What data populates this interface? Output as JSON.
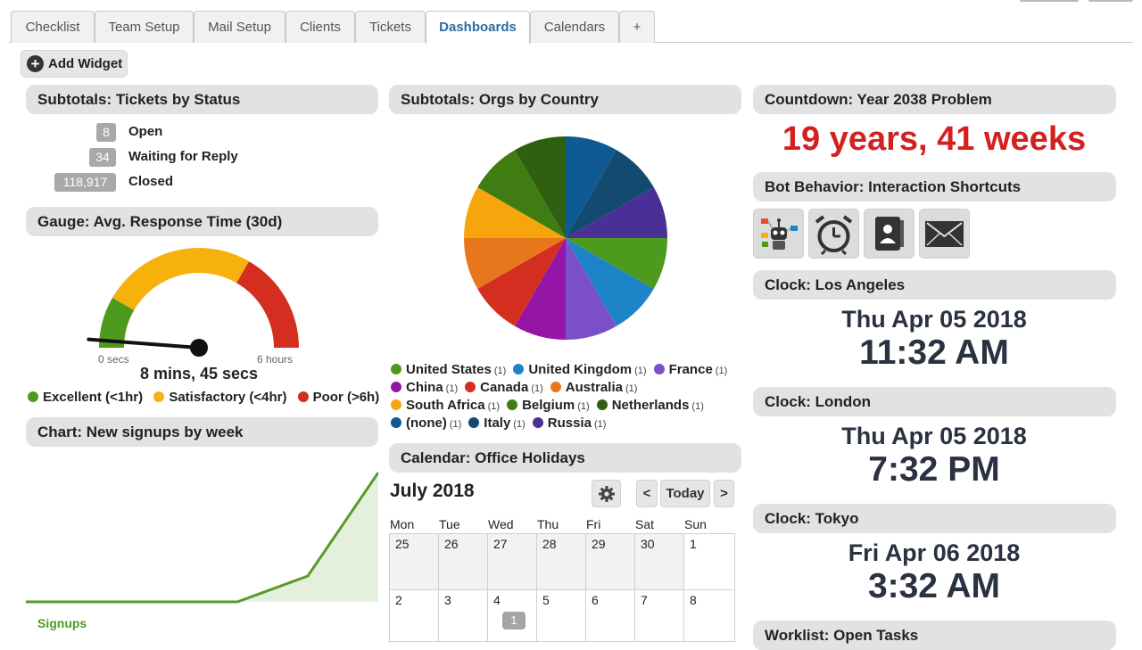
{
  "tabs": [
    {
      "label": "Checklist"
    },
    {
      "label": "Team Setup"
    },
    {
      "label": "Mail Setup"
    },
    {
      "label": "Clients"
    },
    {
      "label": "Tickets"
    },
    {
      "label": "Dashboards",
      "active": true
    },
    {
      "label": "Calendars"
    },
    {
      "label": "+"
    }
  ],
  "toolbar": {
    "add_widget": "Add Widget"
  },
  "tickets_status": {
    "title": "Subtotals: Tickets by Status",
    "rows": [
      {
        "count": "8",
        "label": "Open"
      },
      {
        "count": "34",
        "label": "Waiting for Reply"
      },
      {
        "count": "118,917",
        "label": "Closed"
      }
    ]
  },
  "gauge": {
    "title": "Gauge: Avg. Response Time (30d)",
    "min_label": "0 secs",
    "max_label": "6 hours",
    "value_label": "8 mins, 45 secs",
    "value_fraction": 0.024,
    "bands": [
      {
        "label": "Excellent (<1hr)",
        "color": "#4e9a1d",
        "to": 0.167
      },
      {
        "label": "Satisfactory (<4hr)",
        "color": "#f6b10c",
        "to": 0.667
      },
      {
        "label": "Poor (>6h)",
        "color": "#d42e20",
        "to": 1.0
      }
    ]
  },
  "signups_chart": {
    "title": "Chart: New signups by week",
    "legend": "Signups",
    "color": "#5a9a28"
  },
  "chart_data": {
    "type": "area",
    "series": [
      {
        "name": "Signups",
        "values": [
          0,
          0,
          0,
          0,
          1,
          5
        ]
      }
    ],
    "ylim": [
      0,
      5
    ]
  },
  "orgs_country": {
    "title": "Subtotals: Orgs by Country",
    "items": [
      {
        "label": "United States",
        "count": "(1)",
        "color": "#4e9a1d"
      },
      {
        "label": "United Kingdom",
        "count": "(1)",
        "color": "#1e84c8"
      },
      {
        "label": "France",
        "count": "(1)",
        "color": "#7b4fc8"
      },
      {
        "label": "China",
        "count": "(1)",
        "color": "#9516a6"
      },
      {
        "label": "Canada",
        "count": "(1)",
        "color": "#d42e20"
      },
      {
        "label": "Australia",
        "count": "(1)",
        "color": "#e8761c"
      },
      {
        "label": "South Africa",
        "count": "(1)",
        "color": "#f6a60c"
      },
      {
        "label": "Belgium",
        "count": "(1)",
        "color": "#3f7c12"
      },
      {
        "label": "Netherlands",
        "count": "(1)",
        "color": "#2e6010"
      },
      {
        "label": "(none)",
        "count": "(1)",
        "color": "#0f5a94"
      },
      {
        "label": "Italy",
        "count": "(1)",
        "color": "#134a70"
      },
      {
        "label": "Russia",
        "count": "(1)",
        "color": "#4a2f96"
      }
    ]
  },
  "pie_colors": [
    "#0f5a94",
    "#134a70",
    "#4a2f96",
    "#4e9a1d",
    "#1e84c8",
    "#7b4fc8",
    "#9516a6",
    "#d42e20",
    "#e8761c",
    "#f6a60c",
    "#3f7c12",
    "#2e6010"
  ],
  "calendar": {
    "title": "Calendar: Office Holidays",
    "month": "July 2018",
    "today_label": "Today",
    "prev_label": "<",
    "next_label": ">",
    "days_of_week": [
      "Mon",
      "Tue",
      "Wed",
      "Thu",
      "Fri",
      "Sat",
      "Sun"
    ],
    "week1": [
      "25",
      "26",
      "27",
      "28",
      "29",
      "30",
      "1"
    ],
    "week2": [
      "2",
      "3",
      "4",
      "5",
      "6",
      "7",
      "8"
    ],
    "event_badge": "1"
  },
  "countdown": {
    "title": "Countdown: Year 2038 Problem",
    "value": "19 years, 41 weeks"
  },
  "bot_behavior": {
    "title": "Bot Behavior: Interaction Shortcuts",
    "icons": [
      "bot-icon",
      "alarm-clock-icon",
      "contact-book-icon",
      "envelope-icon"
    ]
  },
  "clocks": [
    {
      "title": "Clock: Los Angeles",
      "date": "Thu Apr 05 2018",
      "time": "11:32 AM"
    },
    {
      "title": "Clock: London",
      "date": "Thu Apr 05 2018",
      "time": "7:32 PM"
    },
    {
      "title": "Clock: Tokyo",
      "date": "Fri Apr 06 2018",
      "time": "3:32 AM"
    }
  ],
  "worklist": {
    "title": "Worklist: Open Tasks"
  }
}
